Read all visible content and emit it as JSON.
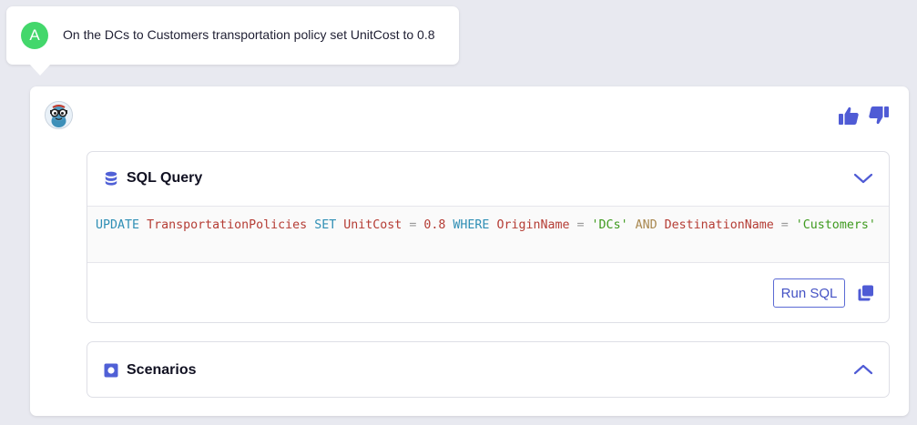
{
  "user_message": {
    "avatar_initial": "A",
    "text": "On the DCs to Customers transportation policy set UnitCost to 0.8"
  },
  "assistant": {
    "avatar_icon": "bot-avatar",
    "feedback": {
      "thumbs_up_icon": "thumbs-up-icon",
      "thumbs_down_icon": "thumbs-down-icon"
    },
    "sql_panel": {
      "icon": "database-icon",
      "title": "SQL Query",
      "chevron": "chevron-down-icon",
      "query": {
        "kw_update": "UPDATE",
        "table": "TransportationPolicies",
        "kw_set": "SET",
        "col_unitcost": "UnitCost",
        "op_eq1": "=",
        "value": "0.8",
        "kw_where": "WHERE",
        "col_origin": "OriginName",
        "op_eq2": "=",
        "origin_value": "'DCs'",
        "kw_and": "AND",
        "col_destination": "DestinationName",
        "op_eq3": "=",
        "destination_value": "'Customers'"
      },
      "run_label": "Run SQL",
      "copy_icon": "copy-icon"
    },
    "scenarios_panel": {
      "icon": "scenarios-icon",
      "title": "Scenarios",
      "chevron": "chevron-up-icon"
    }
  },
  "colors": {
    "accent": "#4f5bd5",
    "user_avatar": "#43d76b",
    "background": "#e8e9f0",
    "sql_keyword": "#2f8fb5",
    "sql_identifier": "#b53d35",
    "sql_string": "#3e9a1e"
  }
}
